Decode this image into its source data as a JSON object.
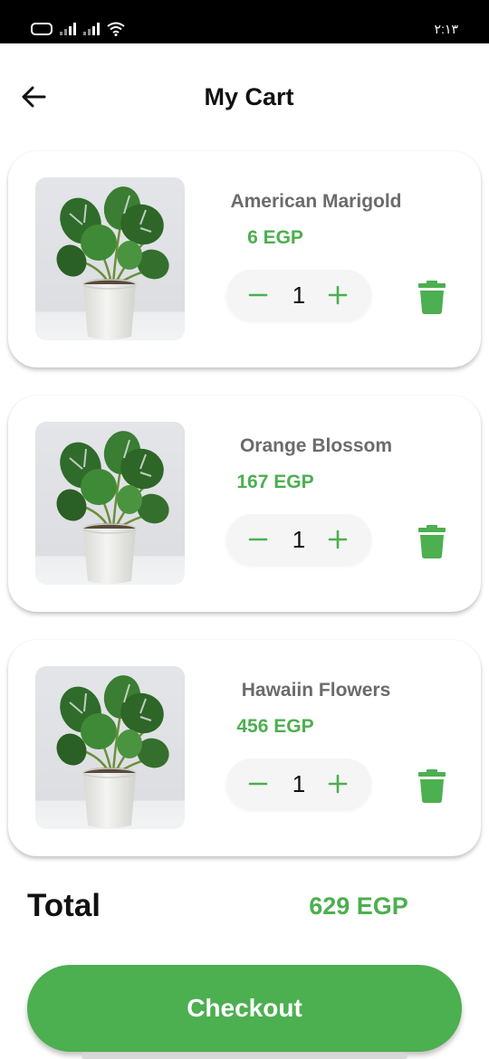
{
  "status_bar": {
    "time": "٢:١٣",
    "icons": [
      "battery-icon",
      "cell-signal-icon",
      "cell-signal-icon",
      "wifi-icon"
    ]
  },
  "header": {
    "back_icon": "arrow-left-icon",
    "title": "My Cart"
  },
  "cart": {
    "items": [
      {
        "name": "American Marigold",
        "price": "6 EGP",
        "quantity": "1",
        "image": "potted-monstera-plant"
      },
      {
        "name": "Orange Blossom",
        "price": "167 EGP",
        "quantity": "1",
        "image": "potted-monstera-plant"
      },
      {
        "name": "Hawaiin Flowers",
        "price": "456 EGP",
        "quantity": "1",
        "image": "potted-monstera-plant"
      }
    ],
    "item_icons": {
      "decrease": "minus-icon",
      "increase": "plus-icon",
      "remove": "trash-icon"
    }
  },
  "summary": {
    "total_label": "Total",
    "total_value": "629 EGP"
  },
  "checkout": {
    "label": "Checkout"
  },
  "colors": {
    "accent": "#4caf50",
    "name_text": "#6b6b6b",
    "status_bar": "#000000",
    "stepper_bg": "#f5f5f5"
  }
}
